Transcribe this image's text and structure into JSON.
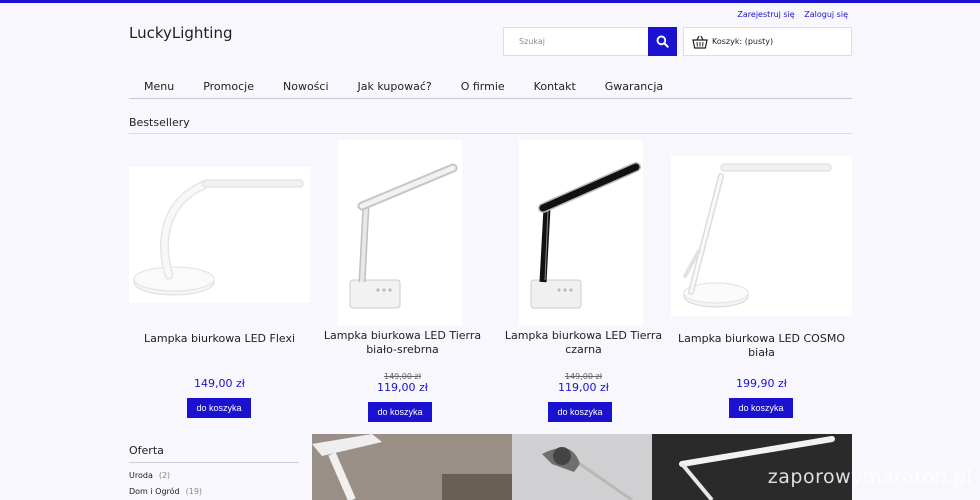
{
  "header": {
    "logo": "LuckyLighting",
    "register": "Zarejestruj się",
    "login": "Zaloguj się",
    "search_placeholder": "Szukaj",
    "cart_label": "Koszyk: (pusty)"
  },
  "nav": [
    "Menu",
    "Promocje",
    "Nowości",
    "Jak kupować?",
    "O firmie",
    "Kontakt",
    "Gwarancja"
  ],
  "bestsellers": {
    "title": "Bestsellery",
    "products": [
      {
        "name": "Lampka biurkowa LED Flexi",
        "old_price": "",
        "price": "149,00 zł",
        "button": "do koszyka"
      },
      {
        "name": "Lampka biurkowa LED Tierra biało-srebrna",
        "old_price": "149,00 zł",
        "price": "119,00 zł",
        "button": "do koszyka"
      },
      {
        "name": "Lampka biurkowa LED Tierra czarna",
        "old_price": "149,00 zł",
        "price": "119,00 zł",
        "button": "do koszyka"
      },
      {
        "name": "Lampka biurkowa LED COSMO biała",
        "old_price": "",
        "price": "199,90 zł",
        "button": "do koszyka"
      }
    ]
  },
  "sidebar": {
    "title": "Oferta",
    "categories": [
      {
        "label": "Uroda",
        "count": "(2)"
      },
      {
        "label": "Dom i Ogród",
        "count": "(19)"
      }
    ]
  },
  "watermark": "zaporowymaraton.pl",
  "colors": {
    "accent": "#1a12d0",
    "background": "#f7f7fd"
  }
}
